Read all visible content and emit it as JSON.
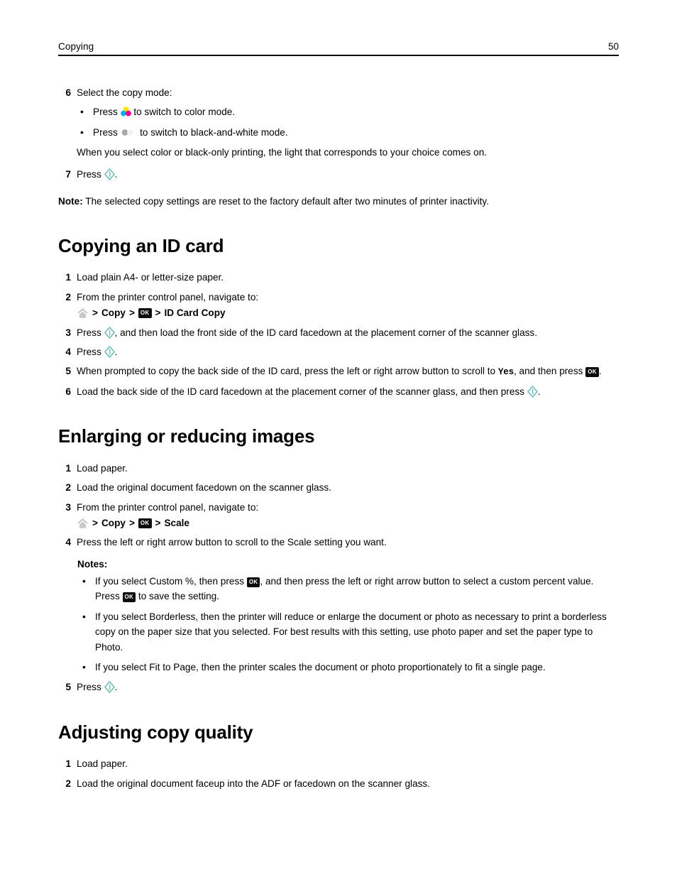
{
  "header": {
    "title": "Copying",
    "page_number": "50"
  },
  "icons": {
    "home": "home-icon",
    "ok_key": "OK",
    "start": "start-button-icon",
    "color_mode": "color-mode-icon",
    "bw_mode": "black-and-white-mode-icon"
  },
  "top_section": {
    "step6": {
      "number": "6",
      "text": "Select the copy mode:",
      "bullets": [
        {
          "before": "Press",
          "after": "to switch to color mode.",
          "icon": "color-mode-icon"
        },
        {
          "before": "Press",
          "after": "to switch to black-and-white mode.",
          "icon": "black-and-white-mode-icon"
        }
      ],
      "sub_text": "When you select color or black-only printing, the light that corresponds to your choice comes on."
    },
    "step7": {
      "number": "7",
      "before": "Press",
      "after": "."
    },
    "note": {
      "label": "Note:",
      "text": " The selected copy settings are reset to the factory default after two minutes of printer inactivity."
    }
  },
  "sections": [
    {
      "heading": "Copying an ID card",
      "steps": [
        {
          "number": "1",
          "text": "Load plain A4- or letter-size paper."
        },
        {
          "number": "2",
          "text": "From the printer control panel, navigate to:"
        },
        {
          "number": "3",
          "before": "Press",
          "after": ", and then load the front side of the ID card facedown at the placement corner of the scanner glass."
        },
        {
          "number": "4",
          "before": "Press",
          "after": "."
        },
        {
          "number": "5",
          "part1": "When prompted to copy the back side of the ID card, press the left or right arrow button to scroll to ",
          "mono": "Yes",
          "part2": ", and then press ",
          "part3": "."
        },
        {
          "number": "6",
          "before": "Load the back side of the ID card facedown at the placement corner of the scanner glass, and then press ",
          "after": "."
        }
      ],
      "nav_path": {
        "crumb1": "Copy",
        "crumb2": "ID Card Copy",
        "separator": ">"
      }
    },
    {
      "heading": "Enlarging or reducing images",
      "steps": [
        {
          "number": "1",
          "text": "Load paper."
        },
        {
          "number": "2",
          "text": "Load the original document facedown on the scanner glass."
        },
        {
          "number": "3",
          "text": "From the printer control panel, navigate to:"
        },
        {
          "number": "4",
          "text": "Press the left or right arrow button to scroll to the Scale setting you want."
        },
        {
          "number": "5",
          "before": "Press",
          "after": "."
        }
      ],
      "nav_path": {
        "crumb1": "Copy",
        "crumb2": "Scale",
        "separator": ">"
      },
      "notes_label": "Notes:",
      "notes": [
        {
          "part1": "If you select Custom %, then press ",
          "part2": ", and then press the left or right arrow button to select a custom percent value. Press ",
          "part3": " to save the setting."
        },
        {
          "text": "If you select Borderless, then the printer will reduce or enlarge the document or photo as necessary to print a borderless copy on the paper size that you selected. For best results with this setting, use photo paper and set the paper type to Photo."
        },
        {
          "text": "If you select Fit to Page, then the printer scales the document or photo proportionately to fit a single page."
        }
      ]
    },
    {
      "heading": "Adjusting copy quality",
      "steps": [
        {
          "number": "1",
          "text": "Load paper."
        },
        {
          "number": "2",
          "text": "Load the original document faceup into the ADF or facedown on the scanner glass."
        }
      ]
    }
  ],
  "colors": {
    "start_teal": "#6fbfb8",
    "cyan": "#00aeef",
    "magenta": "#ec008c",
    "yellow": "#ffe400",
    "home_gray": "#b4b4b4",
    "ok_black": "#0b0b0b"
  }
}
